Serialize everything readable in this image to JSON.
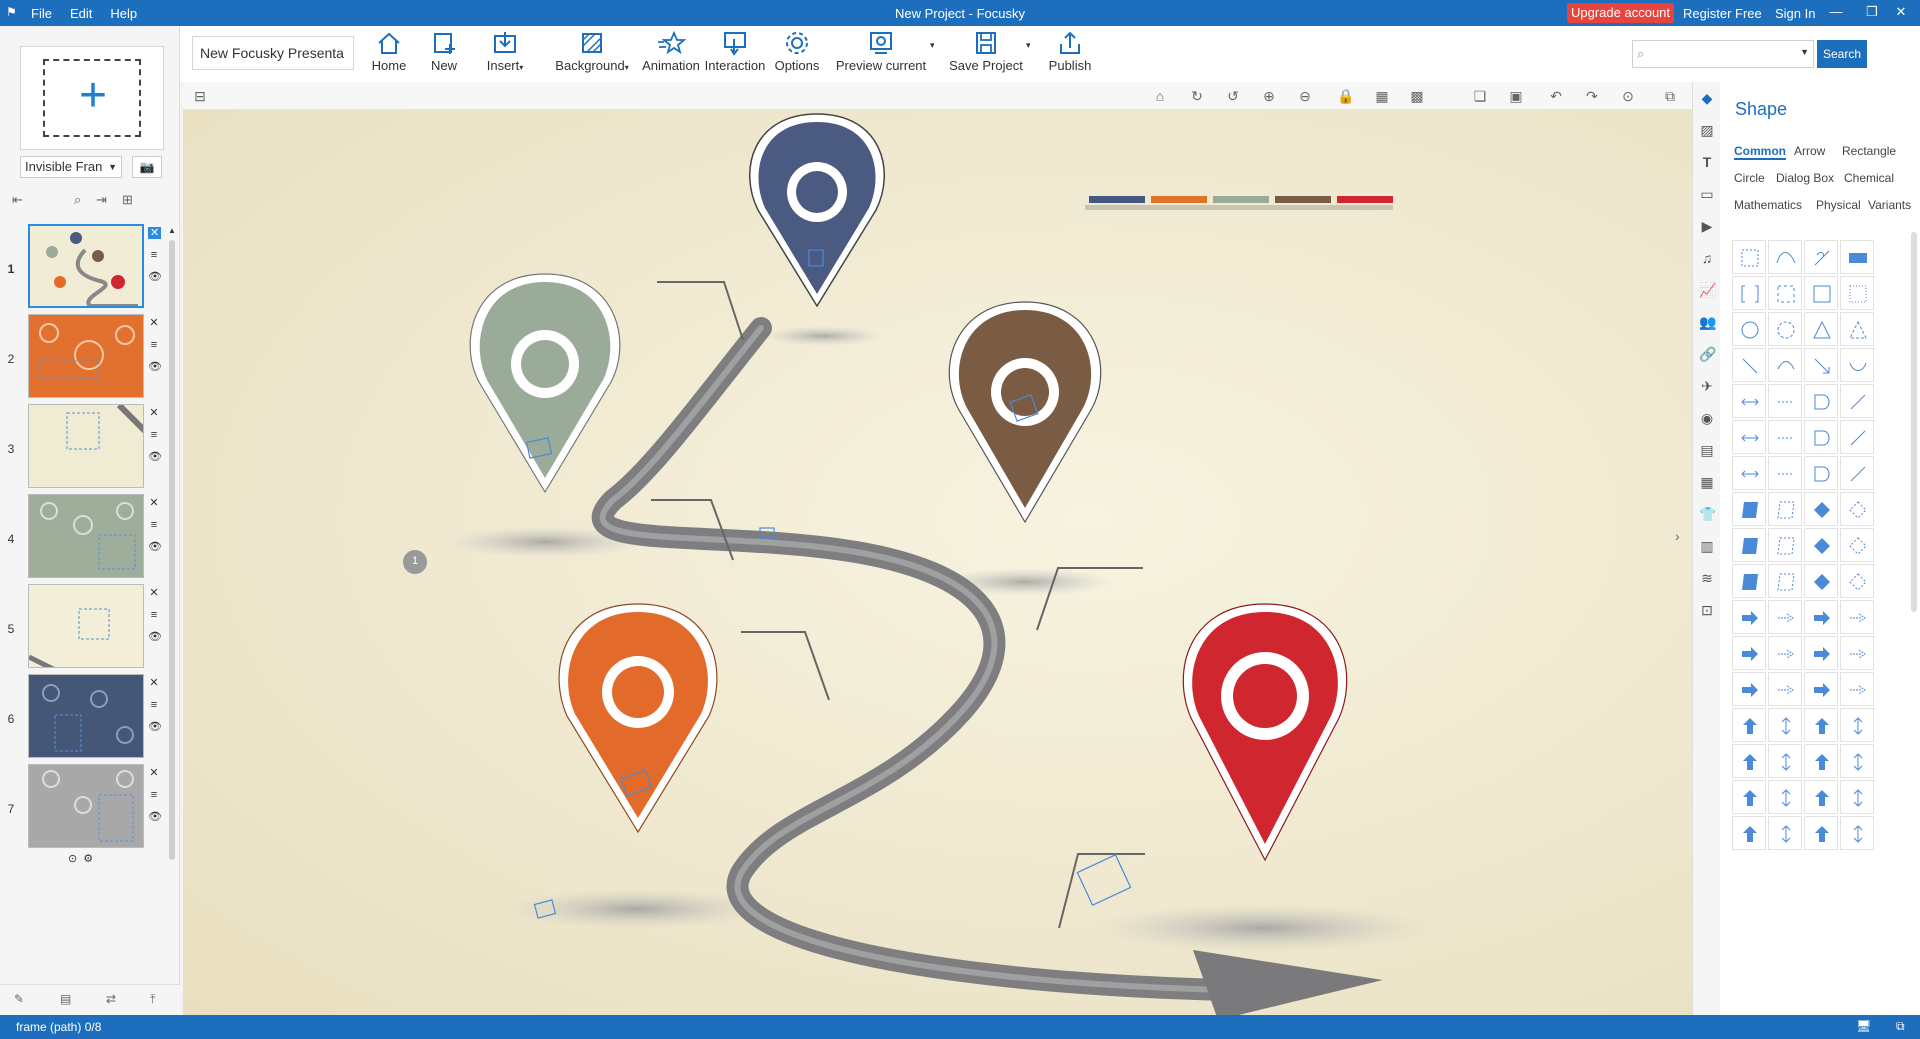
{
  "titlebar": {
    "menu": [
      "File",
      "Edit",
      "Help"
    ],
    "title": "New Project - Focusky",
    "upgrade": "Upgrade account",
    "register": "Register Free",
    "signin": "Sign In"
  },
  "toolbar": {
    "project_name": "New Focusky Presenta",
    "buttons": {
      "home": "Home",
      "new": "New",
      "insert": "Insert",
      "background": "Background",
      "animation": "Animation",
      "interaction": "Interaction",
      "options": "Options",
      "preview": "Preview current",
      "save": "Save Project",
      "publish": "Publish"
    },
    "search_placeholder": "",
    "search_label": "Search"
  },
  "left_panel": {
    "frame_type": "Invisible Fran",
    "slides": [
      {
        "num": "1",
        "bg": "#f1ecd6"
      },
      {
        "num": "2",
        "bg": "#e2702f"
      },
      {
        "num": "3",
        "bg": "#f0ecd4"
      },
      {
        "num": "4",
        "bg": "#9fae9a"
      },
      {
        "num": "5",
        "bg": "#f2eed8"
      },
      {
        "num": "6",
        "bg": "#445777"
      },
      {
        "num": "7",
        "bg": "#a8a8a8"
      }
    ]
  },
  "canvas": {
    "marker_number": "1",
    "pins": [
      {
        "color": "#4a5a80",
        "name": "navy"
      },
      {
        "color": "#9aab9a",
        "name": "sage"
      },
      {
        "color": "#7a5c44",
        "name": "brown"
      },
      {
        "color": "#e26a2a",
        "name": "orange"
      },
      {
        "color": "#d0262f",
        "name": "red"
      }
    ],
    "legend_colors": [
      "#445880",
      "#e27428",
      "#9aab9a",
      "#7a5c44",
      "#d0262f"
    ]
  },
  "right_panel": {
    "title": "Shape",
    "categories": [
      "Common",
      "Arrow",
      "Rectangle",
      "Circle",
      "Dialog Box",
      "Chemical",
      "Mathematics",
      "Physical",
      "Variants"
    ]
  },
  "statusbar": {
    "text": "frame (path) 0/8"
  }
}
